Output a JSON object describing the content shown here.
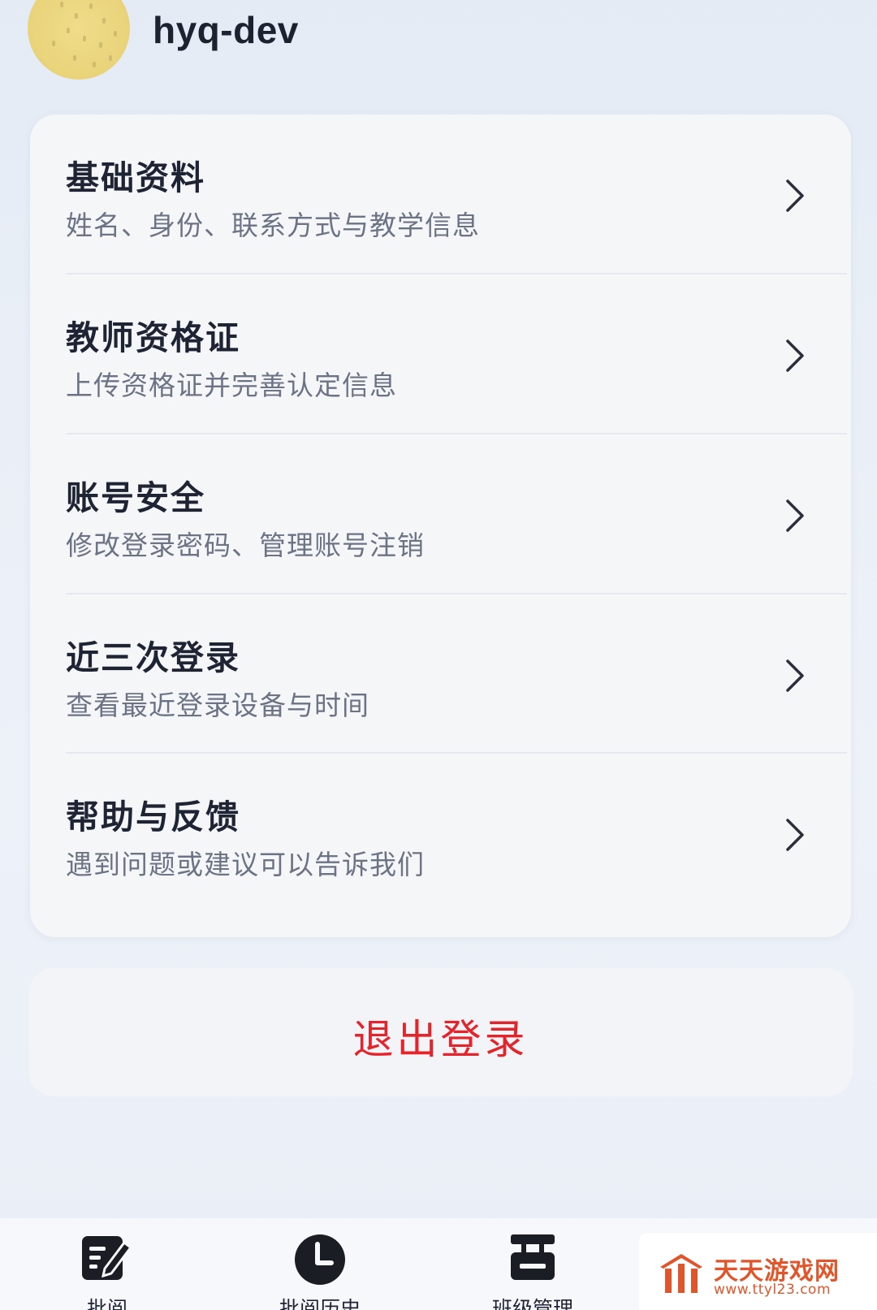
{
  "profile": {
    "username": "hyq-dev"
  },
  "menu": {
    "items": [
      {
        "title": "基础资料",
        "subtitle": "姓名、身份、联系方式与教学信息"
      },
      {
        "title": "教师资格证",
        "subtitle": "上传资格证并完善认定信息"
      },
      {
        "title": "账号安全",
        "subtitle": "修改登录密码、管理账号注销"
      },
      {
        "title": "近三次登录",
        "subtitle": "查看最近登录设备与时间"
      },
      {
        "title": "帮助与反馈",
        "subtitle": "遇到问题或建议可以告诉我们"
      }
    ]
  },
  "logout": {
    "label": "退出登录"
  },
  "tabbar": {
    "items": [
      {
        "label": "批阅",
        "icon": "edit-document-icon"
      },
      {
        "label": "批阅历史",
        "icon": "clock-icon"
      },
      {
        "label": "班级管理",
        "icon": "class-management-icon"
      }
    ]
  },
  "watermark": {
    "name": "天天游戏网",
    "url": "www.ttyl23.com"
  },
  "colors": {
    "logout_red": "#e4242b",
    "watermark_orange": "#e2552a",
    "avatar_yellow": "#ead47c"
  }
}
